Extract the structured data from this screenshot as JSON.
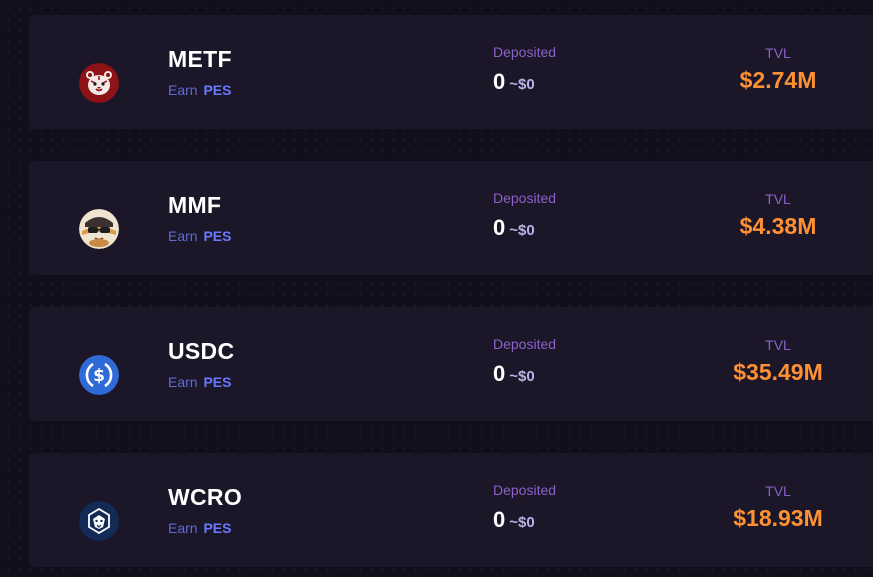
{
  "pools": [
    {
      "token": "METF",
      "earn_label": "Earn",
      "earn_token": "PES",
      "deposited_label": "Deposited",
      "deposited_amount": "0",
      "deposited_usd": "~$0",
      "tvl_label": "TVL",
      "tvl_value": "$2.74M",
      "icon": "metf-tiger-icon"
    },
    {
      "token": "MMF",
      "earn_label": "Earn",
      "earn_token": "PES",
      "deposited_label": "Deposited",
      "deposited_amount": "0",
      "deposited_usd": "~$0",
      "tvl_label": "TVL",
      "tvl_value": "$4.38M",
      "icon": "mmf-cat-icon"
    },
    {
      "token": "USDC",
      "earn_label": "Earn",
      "earn_token": "PES",
      "deposited_label": "Deposited",
      "deposited_amount": "0",
      "deposited_usd": "~$0",
      "tvl_label": "TVL",
      "tvl_value": "$35.49M",
      "icon": "usdc-icon"
    },
    {
      "token": "WCRO",
      "earn_label": "Earn",
      "earn_token": "PES",
      "deposited_label": "Deposited",
      "deposited_amount": "0",
      "deposited_usd": "~$0",
      "tvl_label": "TVL",
      "tvl_value": "$18.93M",
      "icon": "wcro-lion-icon"
    }
  ],
  "colors": {
    "background": "#110f1b",
    "card": "#1b1728",
    "accent_orange": "#ff9135",
    "label_purple": "#8c61c9",
    "earn_blue": "#6a78ff"
  }
}
